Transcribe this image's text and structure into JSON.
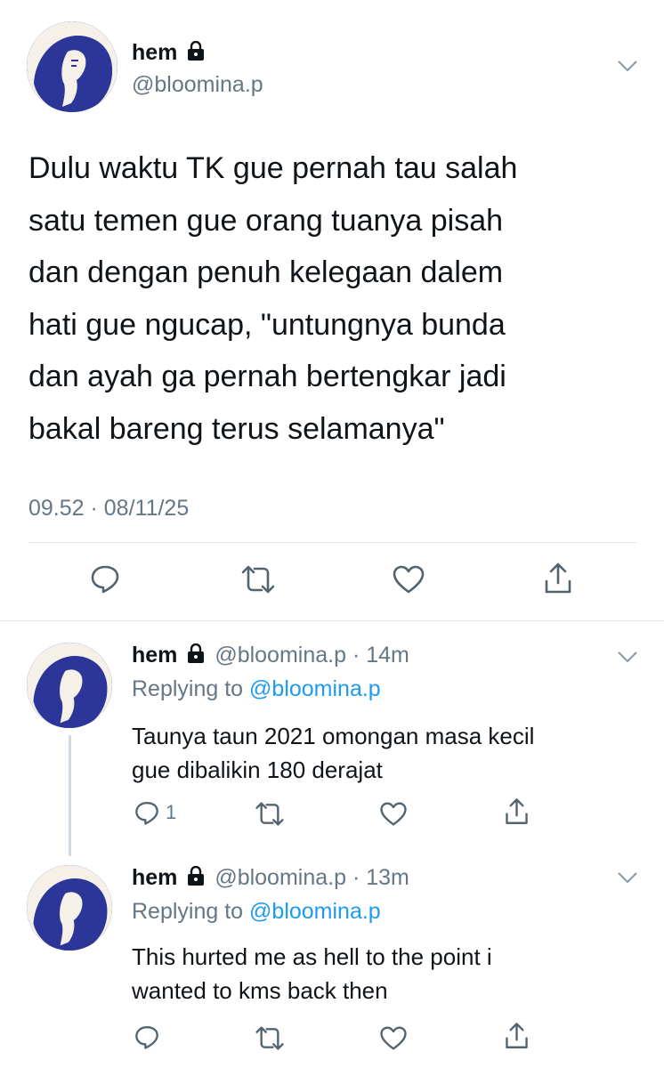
{
  "main_tweet": {
    "display_name": "hem",
    "handle": "@bloomina.p",
    "text_lines": [
      "Dulu waktu TK gue pernah tau salah",
      "satu temen gue orang tuanya pisah",
      "dan dengan penuh kelegaan dalem",
      "hati gue ngucap, \"untungnya bunda",
      "dan ayah ga pernah bertengkar jadi",
      "bakal bareng terus selamanya\""
    ],
    "timestamp": "09.52 · 08/11/25"
  },
  "replies": [
    {
      "display_name": "hem",
      "handle": "@bloomina.p",
      "dot": "·",
      "time": "14m",
      "replying_label": "Replying to",
      "replying_handle": "@bloomina.p",
      "text_lines": [
        "Taunya taun 2021 omongan masa kecil",
        "gue dibalikin 180 derajat"
      ],
      "reply_count": "1"
    },
    {
      "display_name": "hem",
      "handle": "@bloomina.p",
      "dot": "·",
      "time": "13m",
      "replying_label": "Replying to",
      "replying_handle": "@bloomina.p",
      "text_lines": [
        "This hurted me as hell to the point i",
        "wanted to kms back then"
      ],
      "reply_count": ""
    }
  ],
  "icons": {
    "reply": "reply-icon",
    "retweet": "retweet-icon",
    "like": "heart-icon",
    "share": "share-icon",
    "more": "chevron-down-icon",
    "protected": "lock-icon"
  },
  "colors": {
    "text": "#0f1419",
    "muted": "#657786",
    "link": "#1d9bf0",
    "divider": "#e1e8ed",
    "avatar_blue": "#2a3597"
  }
}
